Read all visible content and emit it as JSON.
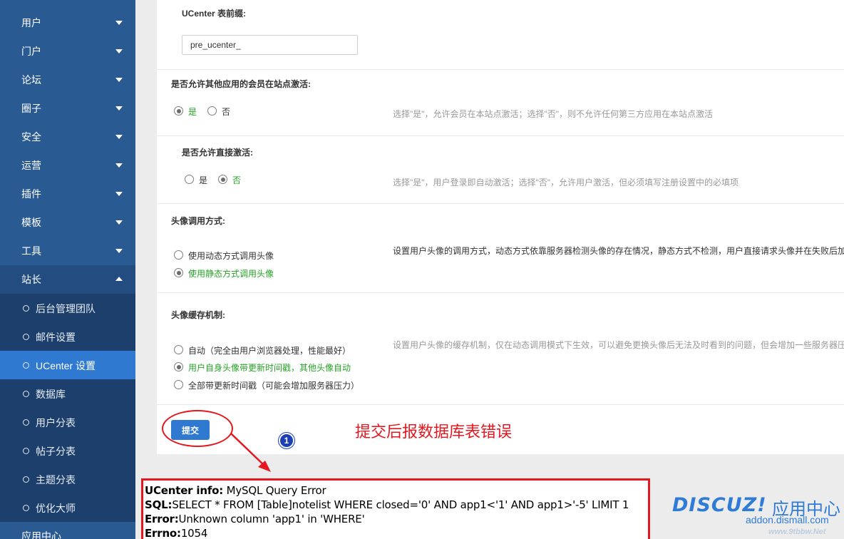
{
  "sidebar": {
    "items": [
      {
        "label": "用户"
      },
      {
        "label": "门户"
      },
      {
        "label": "论坛"
      },
      {
        "label": "圈子"
      },
      {
        "label": "安全"
      },
      {
        "label": "运营"
      },
      {
        "label": "插件"
      },
      {
        "label": "模板"
      },
      {
        "label": "工具"
      },
      {
        "label": "站长"
      }
    ],
    "subitems": [
      {
        "label": "后台管理团队"
      },
      {
        "label": "邮件设置"
      },
      {
        "label": "UCenter 设置",
        "active": true
      },
      {
        "label": "数据库"
      },
      {
        "label": "用户分表"
      },
      {
        "label": "帖子分表"
      },
      {
        "label": "主题分表"
      },
      {
        "label": "优化大师"
      }
    ],
    "bottom_item": {
      "label": "应用中心"
    }
  },
  "form": {
    "prefix": {
      "title": "UCenter 表前缀:",
      "value": "pre_ucenter_"
    },
    "allow_other_activate": {
      "title": "是否允许其他应用的会员在站点激活:",
      "yes": "是",
      "no": "否",
      "selected": "yes",
      "hint": "选择\"是\"，允许会员在本站点激活；选择\"否\"，则不允许任何第三方应用在本站点激活"
    },
    "allow_direct_activate": {
      "title": "是否允许直接激活:",
      "yes": "是",
      "no": "否",
      "selected": "no",
      "hint": "选择\"是\"，用户登录即自动激活；选择\"否\"，允许用户激活，但必须填写注册设置中的必填项"
    },
    "avatar_method": {
      "title": "头像调用方式:",
      "options": [
        "使用动态方式调用头像",
        "使用静态方式调用头像"
      ],
      "selected_index": 1,
      "hint": "设置用户头像的调用方式，动态方式依靠服务器检测头像的存在情况，静态方式不检测，用户直接请求头像并在失败后加"
    },
    "avatar_cache": {
      "title": "头像缓存机制:",
      "options": [
        "自动（完全由用户浏览器处理，性能最好）",
        "用户自身头像带更新时间戳，其他头像自动",
        "全部带更新时间戳（可能会增加服务器压力）"
      ],
      "selected_index": 1,
      "hint": "设置用户头像的缓存机制，仅在动态调用模式下生效，可以避免更换头像后无法及时看到的问题，但会增加一些服务器压"
    },
    "submit_label": "提交"
  },
  "annotation": {
    "badge": "1",
    "text": "提交后报数据库表错误"
  },
  "error": {
    "info_label": "UCenter info:",
    "info_value": " MySQL Query Error",
    "sql_label": "SQL:",
    "sql_value": "SELECT * FROM [Table]notelist WHERE closed='0' AND app1<'1' AND app1>'-5' LIMIT 1",
    "error_label": "Error:",
    "error_value": "Unknown column 'app1' in 'WHERE'",
    "errno_label": "Errno:",
    "errno_value": "1054"
  },
  "watermark": {
    "logo": "DISCUZ!",
    "cn": "应用中心",
    "url": "addon.dismall.com",
    "small": "www.9tbbw.Net"
  },
  "colors": {
    "sidebar": "#2a5a92",
    "sidebar_active": "#2f79d1",
    "accent_red": "#e5171f",
    "selected_green": "#26a326"
  }
}
